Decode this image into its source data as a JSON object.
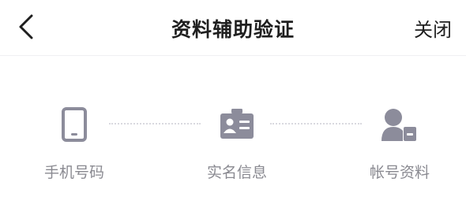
{
  "header": {
    "title": "资料辅助验证",
    "close_label": "关闭",
    "back_icon": "chevron-left-icon"
  },
  "steps": [
    {
      "label": "手机号码",
      "icon": "phone-icon"
    },
    {
      "label": "实名信息",
      "icon": "id-card-icon"
    },
    {
      "label": "帐号资料",
      "icon": "user-account-icon"
    }
  ],
  "colors": {
    "icon": "#8c8c9b",
    "label": "#8a8a91",
    "title": "#1f1f1f",
    "connector": "#d9d9df"
  }
}
